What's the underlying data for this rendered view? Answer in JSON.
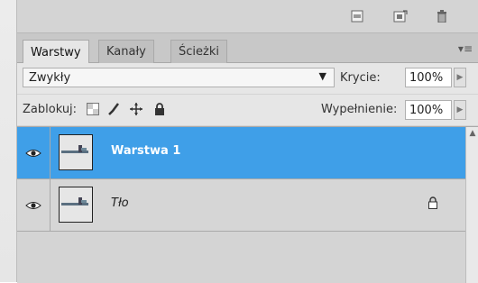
{
  "tabs": [
    {
      "label": "Warstwy",
      "active": true
    },
    {
      "label": "Kanały",
      "active": false
    },
    {
      "label": "Ścieżki",
      "active": false
    }
  ],
  "blend": {
    "mode": "Zwykły",
    "opacity_label": "Krycie:",
    "opacity_value": "100%"
  },
  "lock": {
    "label": "Zablokuj:",
    "fill_label": "Wypełnienie:",
    "fill_value": "100%"
  },
  "layers": [
    {
      "name": "Warstwa 1",
      "selected": true,
      "visible": true
    },
    {
      "name": "Tło",
      "selected": false,
      "visible": true,
      "locked": true
    }
  ],
  "colors": {
    "selection": "#3f9fe8",
    "panel": "#d4d4d4"
  }
}
